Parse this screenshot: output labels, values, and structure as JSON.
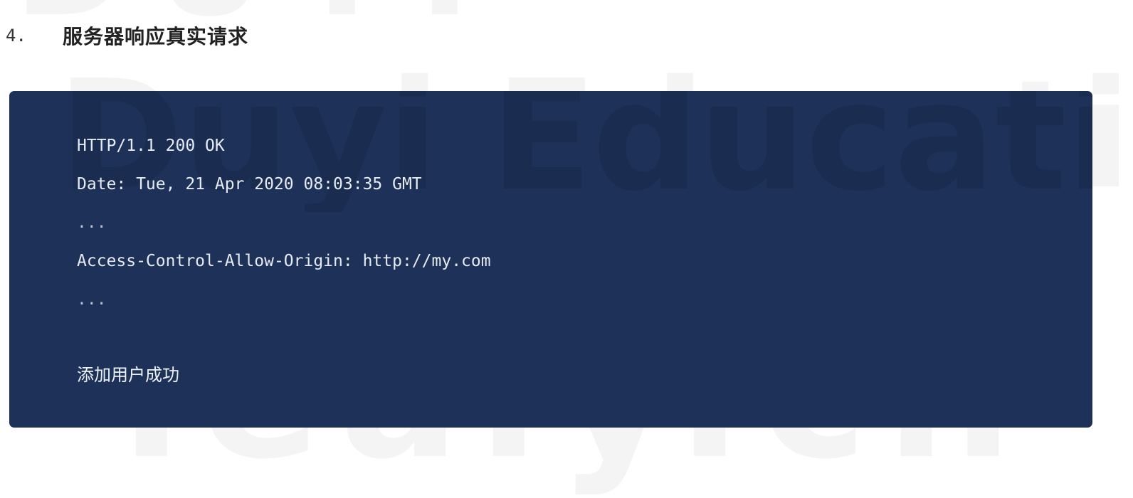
{
  "heading": {
    "number": "4.",
    "text": "服务器响应真实请求"
  },
  "code_block": {
    "lines": [
      "HTTP/1.1 200 OK",
      "Date: Tue, 21 Apr 2020 08:03:35 GMT",
      "...",
      "Access-Control-Allow-Origin: http://my.com",
      "..."
    ],
    "result": "添加用户成功",
    "background_color": "#1e3158"
  }
}
